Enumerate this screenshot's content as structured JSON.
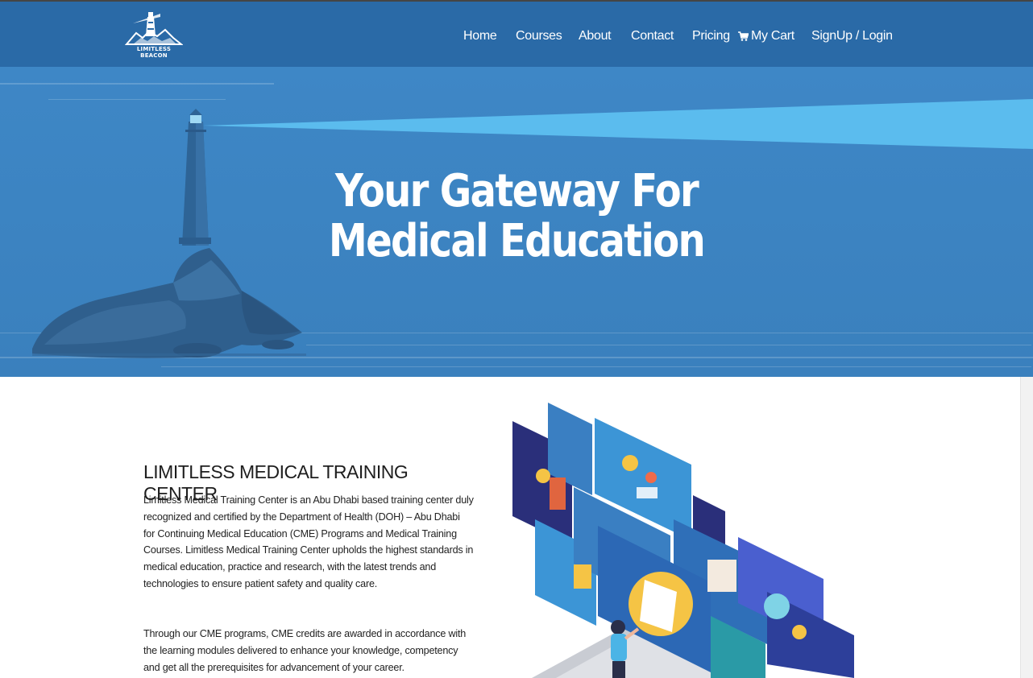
{
  "brand": {
    "logo_text": "LIMITLESS BEACON"
  },
  "nav": {
    "items": [
      {
        "label": "Home"
      },
      {
        "label": "Courses"
      },
      {
        "label": "About"
      },
      {
        "label": "Contact"
      },
      {
        "label": "Pricing"
      },
      {
        "label": "My Cart",
        "icon": "cart-icon"
      },
      {
        "label": "SignUp / Login"
      }
    ]
  },
  "hero": {
    "title_line1": "Your Gateway For",
    "title_line2": "Medical Education"
  },
  "about": {
    "heading": "LIMITLESS MEDICAL TRAINING CENTER",
    "paragraph1": "Limitless Medical Training Center is an Abu Dhabi based training center duly recognized and certified by the Department of Health (DOH) – Abu Dhabi for Continuing Medical Education (CME) Programs and Medical Training Courses. Limitless Medical Training Center upholds the highest standards in medical education, practice and research, with the latest trends and technologies to ensure patient safety and quality care.",
    "paragraph2": "Through our CME programs, CME credits are awarded in accordance with the learning modules delivered to enhance your knowledge, competency and get all the prerequisites for advancement of your career."
  },
  "colors": {
    "header_bg": "#2a6aa7",
    "hero_bg": "#3e87c6",
    "beam": "#5bbcee",
    "text_dark": "#222222"
  }
}
